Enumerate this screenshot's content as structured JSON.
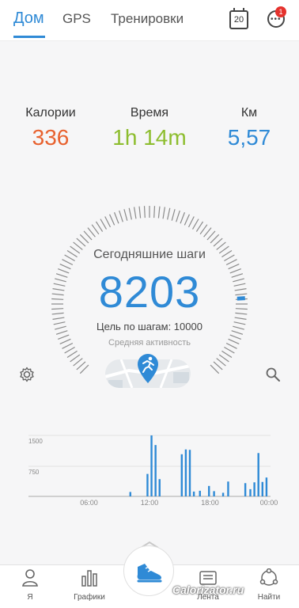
{
  "header": {
    "tabs": [
      {
        "label": "Дом",
        "active": true
      },
      {
        "label": "GPS",
        "active": false
      },
      {
        "label": "Тренировки",
        "active": false
      }
    ],
    "calendar_day": "20",
    "notification_count": "1",
    "accent_color": "#2f8ad6"
  },
  "stats": {
    "calories": {
      "label": "Калории",
      "value": "336",
      "color": "#e8622f"
    },
    "time": {
      "label": "Время",
      "value": "1h 14m",
      "color": "#8dbd2e"
    },
    "distance": {
      "label": "Км",
      "value": "5,57",
      "color": "#2f8ad6"
    }
  },
  "steps": {
    "title": "Сегодняшние шаги",
    "count": "8203",
    "goal_text": "Цель по шагам: 10000",
    "activity_text": "Средняя активность",
    "goal_value": 10000,
    "progress": 0.8203
  },
  "chart_data": {
    "type": "bar",
    "y_ticks": [
      "1500",
      "750"
    ],
    "x_ticks": [
      "06:00",
      "12:00",
      "18:00",
      "00:00"
    ],
    "ylim": [
      0,
      1750
    ],
    "x_range_hours": [
      0,
      24
    ],
    "bars": [
      {
        "hour": 10.1,
        "value": 110
      },
      {
        "hour": 11.8,
        "value": 560
      },
      {
        "hour": 12.2,
        "value": 1520
      },
      {
        "hour": 12.6,
        "value": 1280
      },
      {
        "hour": 13.0,
        "value": 430
      },
      {
        "hour": 15.2,
        "value": 1050
      },
      {
        "hour": 15.6,
        "value": 1170
      },
      {
        "hour": 16.0,
        "value": 1160
      },
      {
        "hour": 16.4,
        "value": 120
      },
      {
        "hour": 17.0,
        "value": 140
      },
      {
        "hour": 17.9,
        "value": 260
      },
      {
        "hour": 18.4,
        "value": 130
      },
      {
        "hour": 19.3,
        "value": 90
      },
      {
        "hour": 19.8,
        "value": 370
      },
      {
        "hour": 21.5,
        "value": 330
      },
      {
        "hour": 22.0,
        "value": 180
      },
      {
        "hour": 22.4,
        "value": 350
      },
      {
        "hour": 22.8,
        "value": 1080
      },
      {
        "hour": 23.2,
        "value": 360
      },
      {
        "hour": 23.6,
        "value": 470
      }
    ]
  },
  "bottom_nav": {
    "items": [
      {
        "label": "Я"
      },
      {
        "label": "Графики"
      },
      {
        "label": "Лента"
      },
      {
        "label": "Найти"
      }
    ]
  },
  "watermark": "Calorizator.ru"
}
